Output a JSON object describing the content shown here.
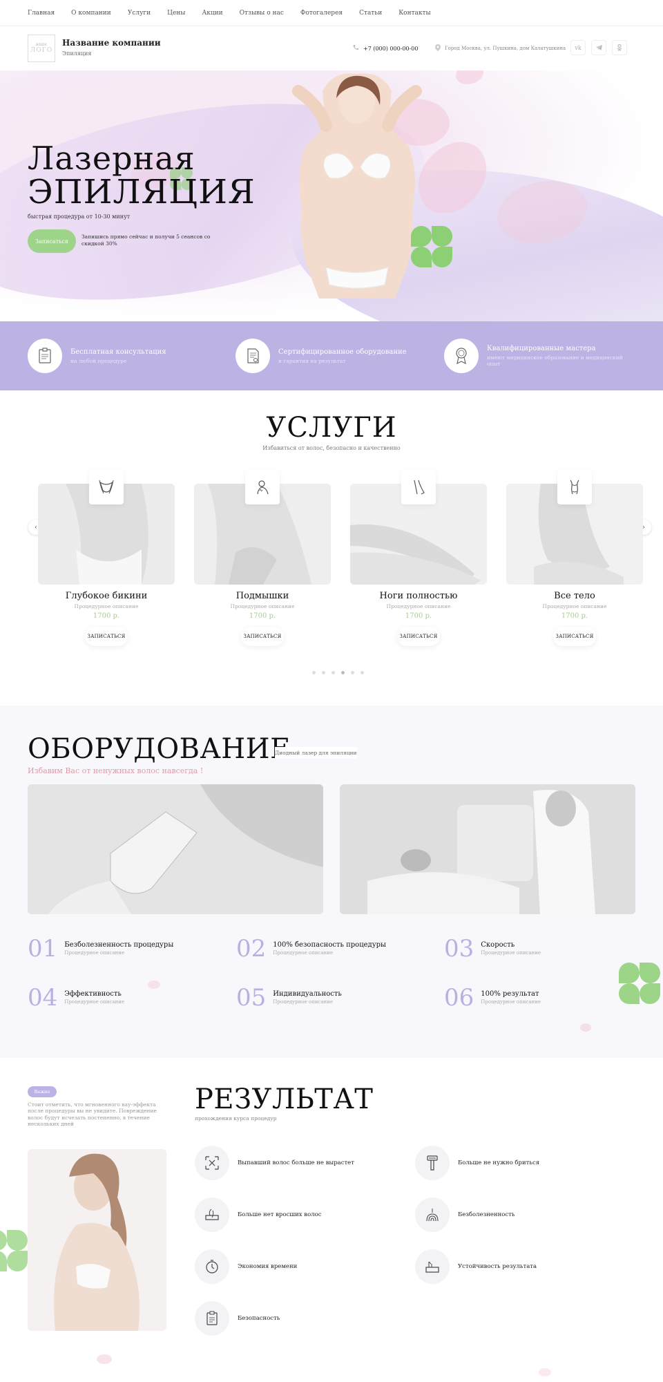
{
  "nav": [
    "Главная",
    "О компании",
    "Услуги",
    "Цены",
    "Акции",
    "Отзывы о нас",
    "Фотогалерея",
    "Статьи",
    "Контакты"
  ],
  "header": {
    "logo_top": "ваше",
    "logo_main": "ЛОГО",
    "company": "Название компании",
    "company_sub": "Эпиляция",
    "phone": "+7 (000) 000-00-00",
    "address": "Город Москва, ул. Пушкина, дом Калатушкина",
    "social": [
      "vk-icon",
      "telegram-icon",
      "odnoklassniki-icon"
    ]
  },
  "hero": {
    "title1": "Лазерная",
    "title2": "ЭПИЛЯЦИЯ",
    "subtitle": "быстрая процедура от 10-30 минут",
    "button": "Записаться",
    "note": "Запишись прямо сейчас и получи 5 сеансов со скидкой 30%"
  },
  "features": [
    {
      "title": "Бесплатная консультация",
      "sub": "на любой процедуре",
      "icon": "document-icon"
    },
    {
      "title": "Сертифицированное оборудование",
      "sub": "и гарантия на результат",
      "icon": "certificate-icon"
    },
    {
      "title": "Квалифицированные мастера",
      "sub": "имеют медицинское образование и медицинский опыт",
      "sub_visible": "имеют медицинское образование и медицинский",
      "sub2": "опыт",
      "icon": "award-icon"
    }
  ],
  "services": {
    "title": "УСЛУГИ",
    "subtitle": "Избавиться от волос, безопасно и качественно",
    "items": [
      {
        "name": "Глубокое бикини",
        "desc": "Процедурное описание",
        "price": "1700 р.",
        "button": "ЗАПИСАТЬСЯ",
        "icon": "bikini-icon"
      },
      {
        "name": "Подмышки",
        "desc": "Процедурное описание",
        "price": "1700 р.",
        "button": "ЗАПИСАТЬСЯ",
        "icon": "underarm-icon"
      },
      {
        "name": "Ноги полностью",
        "desc": "Процедурное описание",
        "price": "1700 р.",
        "button": "ЗАПИСАТЬСЯ",
        "icon": "legs-icon"
      },
      {
        "name": "Все тело",
        "desc": "Процедурное описание",
        "price": "1700 р.",
        "button": "ЗАПИСАТЬСЯ",
        "icon": "body-icon"
      }
    ],
    "prev": "‹",
    "next": "›",
    "dots_count": 6,
    "active_dot": 3
  },
  "equipment": {
    "title": "ОБОРУДОВАНИЕ",
    "tag": "Диодный лазер для эпиляции",
    "subtitle": "Избавим Вас от ненужных волос навсегда !",
    "advantages": [
      {
        "num": "01",
        "title": "Безболезненность процедуры",
        "sub": "Процедурное описание"
      },
      {
        "num": "02",
        "title": "100% безопасность процедуры",
        "sub": "Процедурное описание"
      },
      {
        "num": "03",
        "title": "Скорость",
        "sub": "Процедурное описание"
      },
      {
        "num": "04",
        "title": "Эффективность",
        "sub": "Процедурное описание"
      },
      {
        "num": "05",
        "title": "Индивидуальность",
        "sub": "Процедурное описание"
      },
      {
        "num": "06",
        "title": "100% результат",
        "sub": "Процедурное описание"
      }
    ]
  },
  "result": {
    "tag": "Важно",
    "note": "Стоит отметить, что мгновенного вау-эффекта после процедуры вы не увидите. Повреждение волос будут исчезать постепенно, в течение нескольких дней",
    "title": "РЕЗУЛЬТАТ",
    "subtitle": "прохождения курса процедур",
    "items": [
      {
        "text": "Выпавший волос больше не вырастет",
        "icon": "hair-removal-icon"
      },
      {
        "text": "Больше не нужно бриться",
        "icon": "razor-icon"
      },
      {
        "text": "Больше нет вросших волос",
        "icon": "ingrown-hair-icon"
      },
      {
        "text": "Безболезненность",
        "icon": "painless-icon"
      },
      {
        "text": "Экономия времени",
        "icon": "timer-icon"
      },
      {
        "text": "Устойчивость результата",
        "icon": "stable-result-icon"
      },
      {
        "text": "Безопасность",
        "icon": "safety-doc-icon"
      }
    ]
  },
  "colors": {
    "accent": "#bcb2e4",
    "green": "#9ed38a",
    "pink": "#e09aa8",
    "price": "#a7cc8f"
  }
}
